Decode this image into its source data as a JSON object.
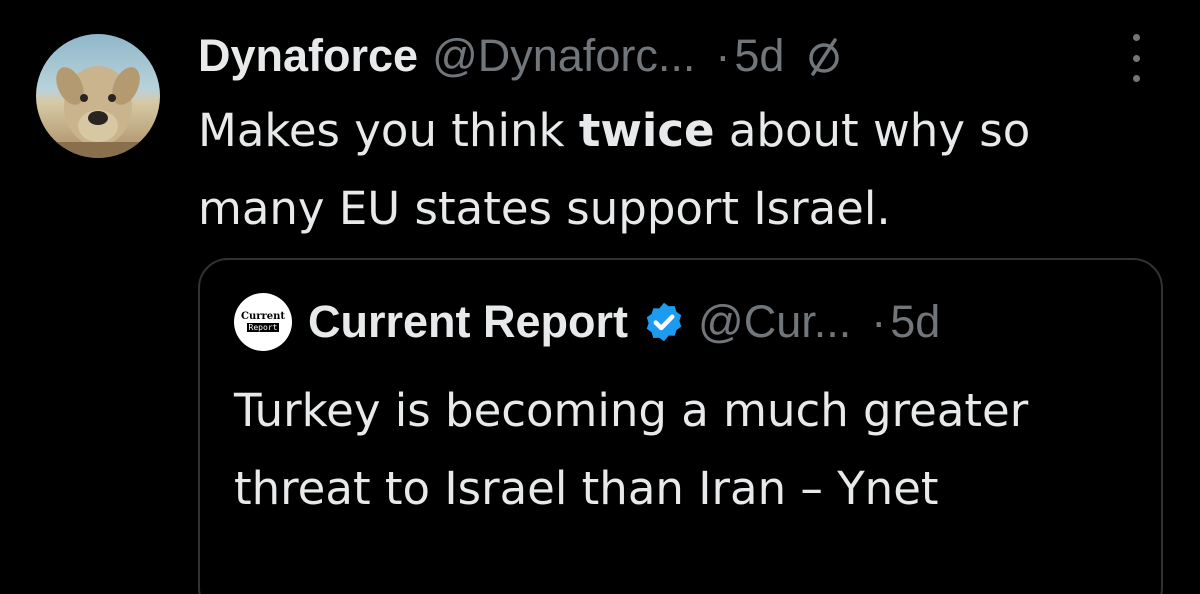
{
  "tweet": {
    "author": {
      "display_name": "Dynaforce",
      "handle": "@Dynaforc...",
      "avatar": "dog-avatar"
    },
    "separator": "·",
    "time": "5d",
    "mute_icon": "muted-circle-slash-icon",
    "more_icon": "vertical-ellipsis-icon",
    "text": {
      "part1": "Makes you think ",
      "bold": "twice",
      "part2": " about why so many EU states support Israel."
    }
  },
  "quote": {
    "author": {
      "display_name": "Current Report",
      "handle": "@Cur...",
      "avatar_line1": "Current",
      "avatar_line2": "Report",
      "verified": true
    },
    "separator": "·",
    "time": "5d",
    "text": "Turkey is becoming a much greater threat to Israel than Iran – Ynet"
  },
  "colors": {
    "background": "#000000",
    "text_primary": "#e7e9ea",
    "text_secondary": "#71767b",
    "border": "#2f3336",
    "verified_blue": "#1d9bf0"
  }
}
